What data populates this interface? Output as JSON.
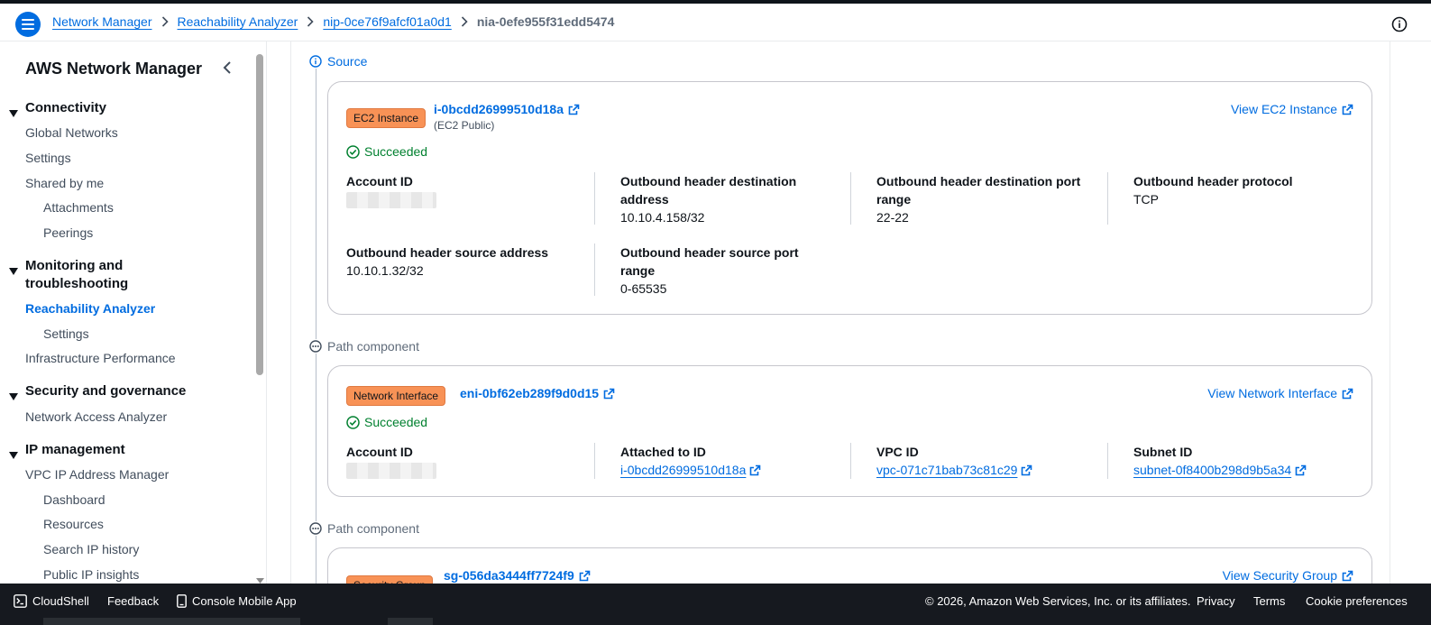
{
  "breadcrumbs": {
    "items": [
      "Network Manager",
      "Reachability Analyzer",
      "nip-0ce76f9afcf01a0d1"
    ],
    "current": "nia-0efe955f31edd5474"
  },
  "sidebar": {
    "title": "AWS Network Manager",
    "sections": [
      {
        "label": "Connectivity",
        "items": [
          {
            "label": "Global Networks"
          },
          {
            "label": "Settings"
          },
          {
            "label": "Shared by me"
          },
          {
            "label": "Attachments"
          },
          {
            "label": "Peerings"
          }
        ]
      },
      {
        "label": "Monitoring and troubleshooting",
        "items": [
          {
            "label": "Reachability Analyzer"
          },
          {
            "label": "Settings"
          },
          {
            "label": "Infrastructure Performance"
          }
        ]
      },
      {
        "label": "Security and governance",
        "items": [
          {
            "label": "Network Access Analyzer"
          }
        ]
      },
      {
        "label": "IP management",
        "items": [
          {
            "label": "VPC IP Address Manager"
          },
          {
            "label": "Dashboard"
          },
          {
            "label": "Resources"
          },
          {
            "label": "Search IP history"
          },
          {
            "label": "Public IP insights"
          }
        ]
      }
    ]
  },
  "main": {
    "source_label": "Source",
    "source_card": {
      "badge": "EC2 Instance",
      "resource_id": "i-0bcdd26999510d18a",
      "resource_sub": "(EC2 Public)",
      "view_link": "View EC2 Instance",
      "status": "Succeeded",
      "fields": [
        {
          "key": "Account ID",
          "value": ""
        },
        {
          "key": "Outbound header destination address",
          "value": "10.10.4.158/32"
        },
        {
          "key": "Outbound header destination port range",
          "value": "22-22"
        },
        {
          "key": "Outbound header protocol",
          "value": "TCP"
        },
        {
          "key": "Outbound header source address",
          "value": "10.10.1.32/32"
        },
        {
          "key": "Outbound header source port range",
          "value": "0-65535"
        }
      ]
    },
    "path_label_1": "Path component",
    "eni_card": {
      "badge": "Network Interface",
      "resource_id": "eni-0bf62eb289f9d0d15",
      "view_link": "View Network Interface",
      "status": "Succeeded",
      "fields": [
        {
          "key": "Account ID",
          "value": ""
        },
        {
          "key": "Attached to ID",
          "value": "i-0bcdd26999510d18a"
        },
        {
          "key": "VPC ID",
          "value": "vpc-071c71bab73c81c29"
        },
        {
          "key": "Subnet ID",
          "value": "subnet-0f8400b298d9b5a34"
        }
      ]
    },
    "path_label_2": "Path component",
    "sg_card": {
      "badge": "Security Group",
      "resource_id": "sg-056da3444ff7724f9",
      "view_link": "View Security Group"
    }
  },
  "footer": {
    "cloudshell": "CloudShell",
    "feedback": "Feedback",
    "mobile_app": "Console Mobile App",
    "copyright": "© 2026, Amazon Web Services, Inc. or its affiliates.",
    "privacy": "Privacy",
    "terms": "Terms",
    "cookies": "Cookie preferences"
  },
  "colors": {
    "link": "#006ce0",
    "success": "#00802f",
    "badge": "#f89256",
    "footer_bg": "#16191f"
  }
}
